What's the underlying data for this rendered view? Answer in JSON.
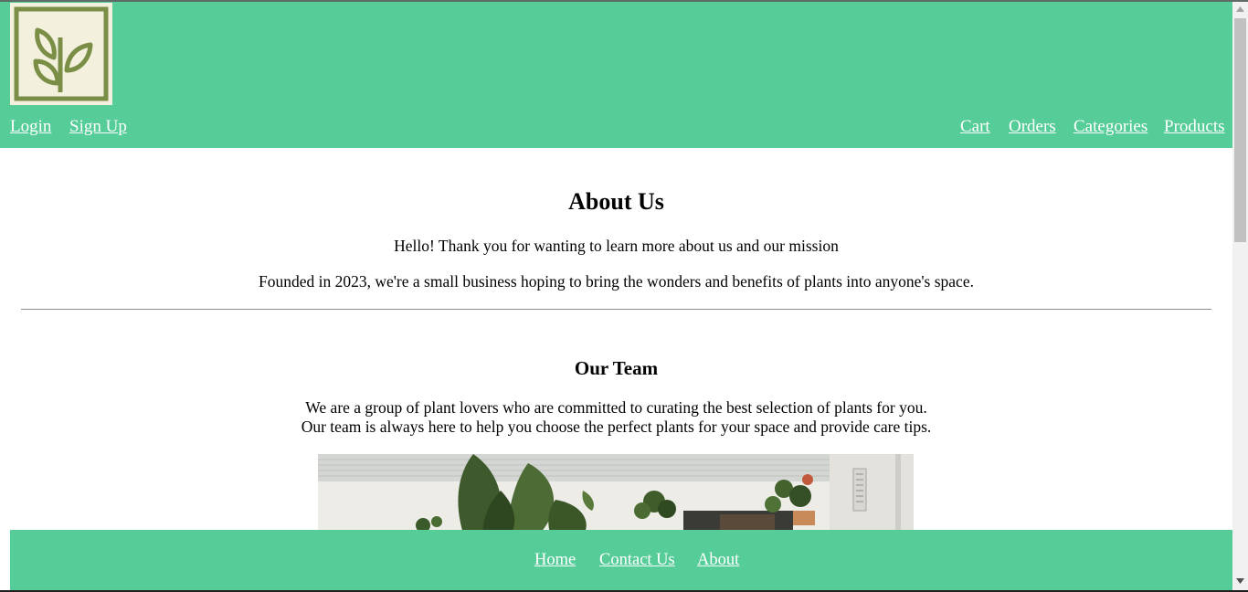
{
  "header": {
    "logo_alt": "plant-logo",
    "nav_left": [
      {
        "label": "Login"
      },
      {
        "label": "Sign Up"
      }
    ],
    "nav_right": [
      {
        "label": "Cart"
      },
      {
        "label": "Orders"
      },
      {
        "label": "Categories"
      },
      {
        "label": "Products"
      }
    ]
  },
  "about": {
    "title": "About Us",
    "intro": "Hello! Thank you for wanting to learn more about us and our mission",
    "founded": "Founded in 2023, we're a small business hoping to bring the wonders and benefits of plants into anyone's space."
  },
  "team": {
    "title": "Our Team",
    "line1": "We are a group of plant lovers who are committed to curating the best selection of plants for you.",
    "line2": "Our team is always here to help you choose the perfect plants for your space and provide care tips."
  },
  "footer": {
    "links": [
      {
        "label": "Home"
      },
      {
        "label": "Contact Us"
      },
      {
        "label": "About"
      }
    ]
  },
  "colors": {
    "brand_green": "#56cd98",
    "logo_bg": "#f3f1de",
    "logo_green": "#7a8f45"
  }
}
